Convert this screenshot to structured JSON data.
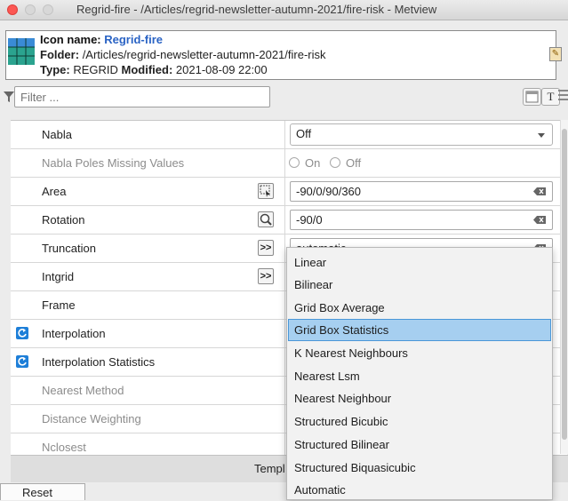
{
  "window": {
    "title": "Regrid-fire - /Articles/regrid-newsletter-autumn-2021/fire-risk - Metview"
  },
  "info": {
    "icon_label": "Icon name:",
    "icon_name": "Regrid-fire",
    "folder_label": "Folder:",
    "folder": "/Articles/regrid-newsletter-autumn-2021/fire-risk",
    "type_label": "Type:",
    "type": "REGRID",
    "modified_label": "Modified:",
    "modified": "2021-08-09 22:00"
  },
  "filter": {
    "placeholder": "Filter ..."
  },
  "toolbar": {
    "text_button": "T"
  },
  "params": {
    "nabla": {
      "label": "Nabla",
      "value": "Off"
    },
    "nabla_poles": {
      "label": "Nabla Poles Missing Values",
      "option_on": "On",
      "option_off": "Off"
    },
    "area": {
      "label": "Area",
      "value": "-90/0/90/360"
    },
    "rotation": {
      "label": "Rotation",
      "value": "-90/0"
    },
    "truncation": {
      "label": "Truncation",
      "value": "automatic",
      "helper": ">>"
    },
    "intgrid": {
      "label": "Intgrid",
      "helper": ">>"
    },
    "frame": {
      "label": "Frame"
    },
    "interpolation": {
      "label": "Interpolation"
    },
    "interpolation_statistics": {
      "label": "Interpolation Statistics"
    },
    "nearest_method": {
      "label": "Nearest Method"
    },
    "distance_weighting": {
      "label": "Distance Weighting"
    },
    "nclosest": {
      "label": "Nclosest"
    }
  },
  "bottom": {
    "templ_label": "Templ",
    "reset_label": "Reset"
  },
  "dropdown": {
    "selected_index": 3,
    "options": [
      "Linear",
      "Bilinear",
      "Grid Box Average",
      "Grid Box Statistics",
      "K Nearest Neighbours",
      "Nearest Lsm",
      "Nearest Neighbour",
      "Structured Bicubic",
      "Structured Bilinear",
      "Structured Biquasicubic",
      "Automatic"
    ]
  }
}
